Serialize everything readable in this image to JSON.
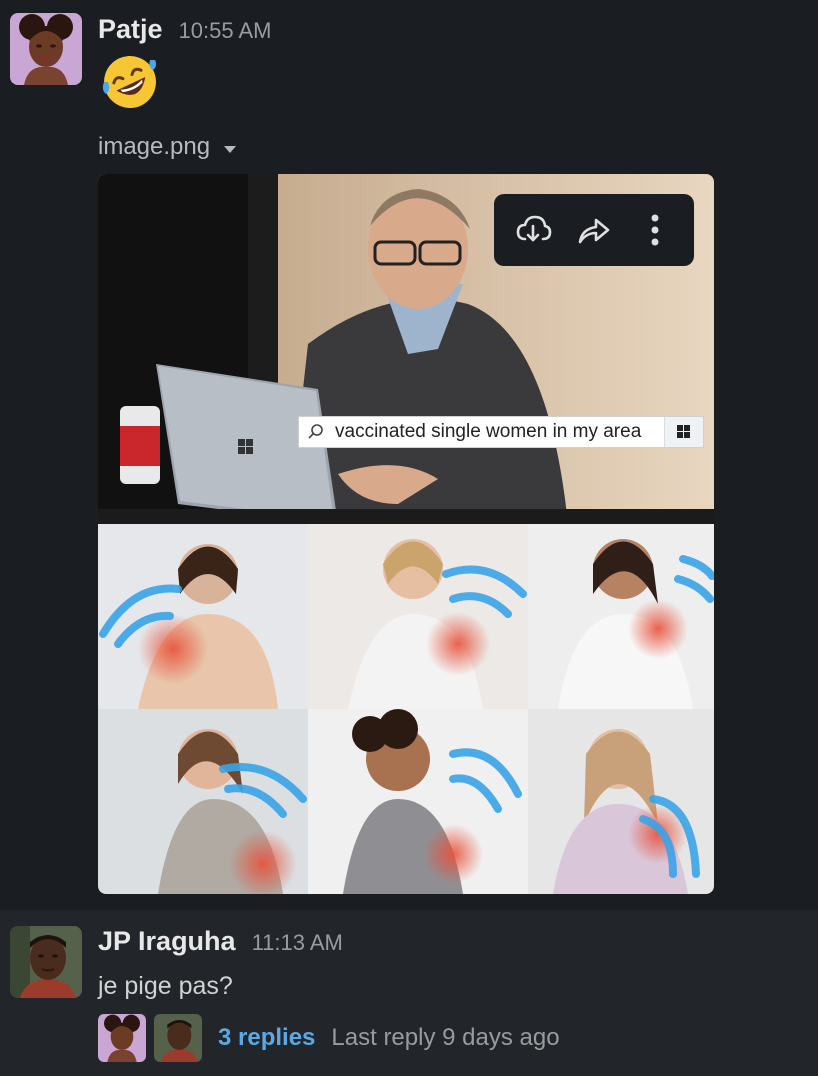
{
  "messages": [
    {
      "user": "Patje",
      "time": "10:55 AM",
      "emoji": "rolling-on-floor-laughing-emoji",
      "file": {
        "name": "image.png",
        "image_search_text": "vaccinated single women in my area",
        "toolbar": [
          "download-icon",
          "share-icon",
          "more-icon"
        ]
      }
    },
    {
      "user": "JP Iraguha",
      "time": "11:13 AM",
      "text": "je pige pas?",
      "thread": {
        "replies": "3 replies",
        "last_reply": "Last reply 9 days ago"
      }
    }
  ],
  "colors": {
    "background": "#1a1d21",
    "hover_background": "#222529",
    "link": "#5aa9e6",
    "muted": "#9a9b9d"
  }
}
